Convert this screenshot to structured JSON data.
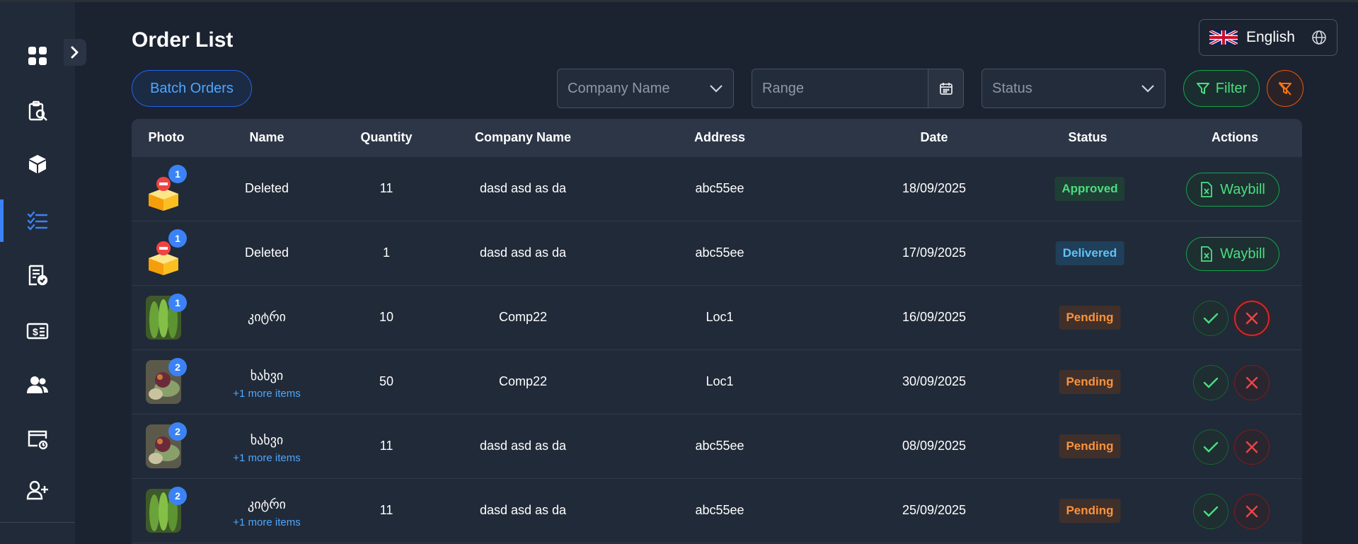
{
  "page": {
    "title": "Order List"
  },
  "language": {
    "label": "English"
  },
  "toolbar": {
    "batch_label": "Batch Orders",
    "company_placeholder": "Company Name",
    "range_placeholder": "Range",
    "status_placeholder": "Status",
    "filter_label": "Filter"
  },
  "sidebar": {
    "items": [
      {
        "icon": "dashboard-grid-icon"
      },
      {
        "icon": "clipboard-search-icon"
      },
      {
        "icon": "box-icon"
      },
      {
        "icon": "checklist-icon",
        "active": true
      },
      {
        "icon": "receipt-check-icon"
      },
      {
        "icon": "dollar-card-icon"
      },
      {
        "icon": "users-icon"
      },
      {
        "icon": "window-history-icon"
      },
      {
        "icon": "user-add-icon"
      }
    ]
  },
  "table": {
    "headers": {
      "photo": "Photo",
      "name": "Name",
      "quantity": "Quantity",
      "company": "Company Name",
      "address": "Address",
      "date": "Date",
      "status": "Status",
      "actions": "Actions"
    },
    "rows": [
      {
        "badge": "1",
        "photo": "box-icon",
        "name": "Deleted",
        "more": "",
        "quantity": "11",
        "company": "dasd asd as da",
        "address": "abc55ee",
        "date": "18/09/2025",
        "status": "Approved",
        "action": "Waybill"
      },
      {
        "badge": "1",
        "photo": "box-icon",
        "name": "Deleted",
        "more": "",
        "quantity": "1",
        "company": "dasd asd as da",
        "address": "abc55ee",
        "date": "17/09/2025",
        "status": "Delivered",
        "action": "Waybill"
      },
      {
        "badge": "1",
        "photo": "cucumber",
        "name": "კიტრი",
        "more": "",
        "quantity": "10",
        "company": "Comp22",
        "address": "Loc1",
        "date": "16/09/2025",
        "status": "Pending"
      },
      {
        "badge": "2",
        "photo": "vegetables",
        "name": "ხახვი",
        "more": "+1 more items",
        "quantity": "50",
        "company": "Comp22",
        "address": "Loc1",
        "date": "30/09/2025",
        "status": "Pending"
      },
      {
        "badge": "2",
        "photo": "vegetables",
        "name": "ხახვი",
        "more": "+1 more items",
        "quantity": "11",
        "company": "dasd asd as da",
        "address": "abc55ee",
        "date": "08/09/2025",
        "status": "Pending"
      },
      {
        "badge": "2",
        "photo": "cucumber",
        "name": "კიტრი",
        "more": "+1 more items",
        "quantity": "11",
        "company": "dasd asd as da",
        "address": "abc55ee",
        "date": "25/09/2025",
        "status": "Pending"
      }
    ]
  },
  "colors": {
    "background": "#1b2331",
    "sidebar": "#212a38",
    "accent_blue": "#3b82f6",
    "success_green": "#4ade80",
    "danger_red": "#ef4444",
    "pending_orange": "#fb923c"
  }
}
